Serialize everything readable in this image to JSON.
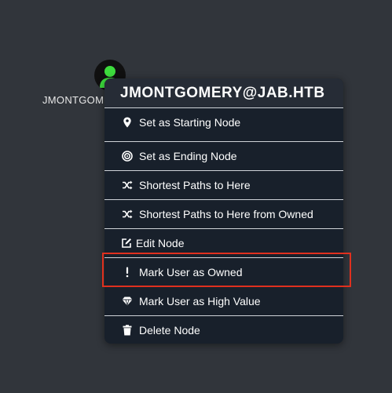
{
  "node": {
    "label": "JMONTGOM",
    "icon": "user-icon",
    "icon_color": "#3ddc3d"
  },
  "menu": {
    "title": "JMONTGOMERY@JAB.HTB",
    "items": [
      {
        "label": "Set as Starting Node",
        "icon": "map-pin-icon"
      },
      {
        "label": "Set as Ending Node",
        "icon": "target-icon"
      },
      {
        "label": "Shortest Paths to Here",
        "icon": "shuffle-icon"
      },
      {
        "label": "Shortest Paths to Here from Owned",
        "icon": "shuffle-icon"
      },
      {
        "label": "Edit Node",
        "icon": "edit-icon"
      },
      {
        "label": "Mark User as Owned",
        "icon": "exclamation-icon"
      },
      {
        "label": "Mark User as High Value",
        "icon": "gem-icon"
      },
      {
        "label": "Delete Node",
        "icon": "trash-icon"
      }
    ]
  },
  "highlight": {
    "color": "#e0301e",
    "target": "Mark User as Owned"
  }
}
